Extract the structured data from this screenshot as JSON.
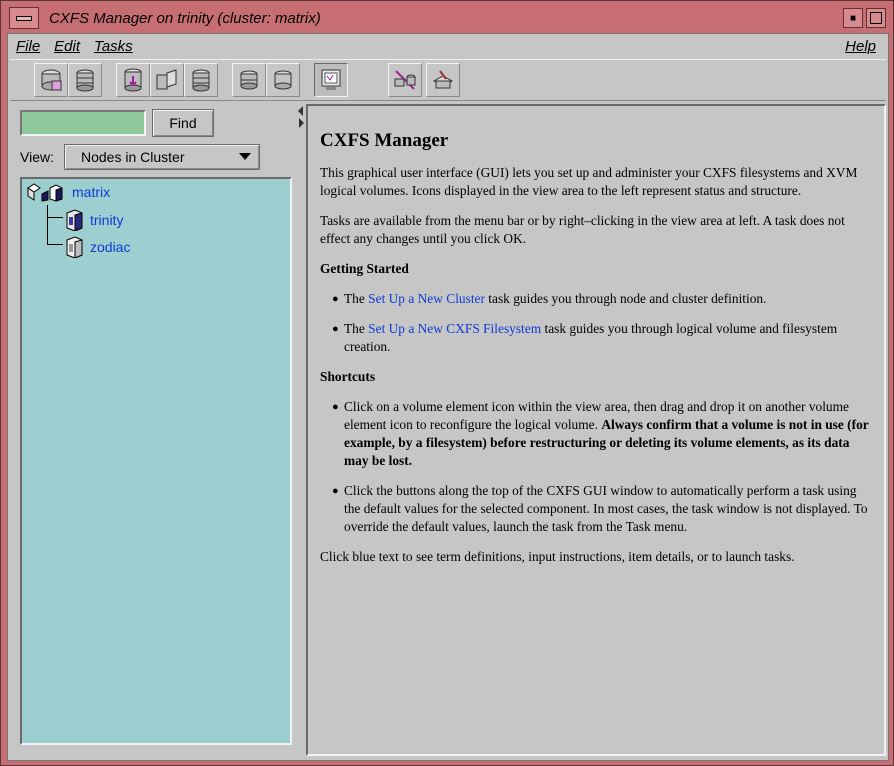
{
  "window": {
    "title": "CXFS Manager on trinity (cluster: matrix)"
  },
  "menubar": {
    "file": "File",
    "edit": "Edit",
    "tasks": "Tasks",
    "help": "Help"
  },
  "toolbar": {
    "buttons": [
      "cluster-config-icon",
      "filesystem-icon",
      "volume-icon",
      "slice-icon",
      "disk-stack-icon",
      "volume-element-icon",
      "disk-icon",
      "monitor-icon",
      "network-icon",
      "tools-icon"
    ]
  },
  "left": {
    "find_value": "",
    "find_label": "Find",
    "view_label": "View:",
    "view_selected": "Nodes in Cluster",
    "tree": {
      "root": "matrix",
      "children": [
        "trinity",
        "zodiac"
      ]
    }
  },
  "right": {
    "title": "CXFS Manager",
    "intro": "This graphical user interface (GUI) lets you set up and administer your CXFS filesystems and XVM logical volumes.  Icons displayed in the view area to the left represent status and structure.",
    "tasks_para": "Tasks are available from the menu bar or by right–clicking in the view area at left.  A task does not effect any changes until you click OK.",
    "getting_started": "Getting Started",
    "gs_items": [
      {
        "pre": "The ",
        "link": "Set Up a New Cluster",
        "post": " task guides you through node and cluster definition."
      },
      {
        "pre": "The ",
        "link": "Set Up a New CXFS Filesystem",
        "post": " task guides you through logical volume and filesystem creation."
      }
    ],
    "shortcuts": "Shortcuts",
    "sc_item1_text": "Click on a volume element icon within the view area, then drag and drop it on another volume element icon to reconfigure the logical volume.  ",
    "sc_item1_bold": "Always confirm that a volume is not in use (for example, by a filesystem) before restructuring or deleting its volume elements, as its data may be lost.",
    "sc_item2": "Click the buttons along the top of the CXFS GUI window to automatically perform a task using the default values for the selected component.  In most cases, the task window is not displayed.  To override the default values, launch the task from the Task menu.",
    "footer": "Click blue text to see term definitions, input instructions, item details, or to launch tasks."
  },
  "colors": {
    "titlebar": "#c76e73",
    "tree_bg": "#9ecfd0",
    "find_field": "#8fc89a",
    "link": "#0d3ad6"
  }
}
